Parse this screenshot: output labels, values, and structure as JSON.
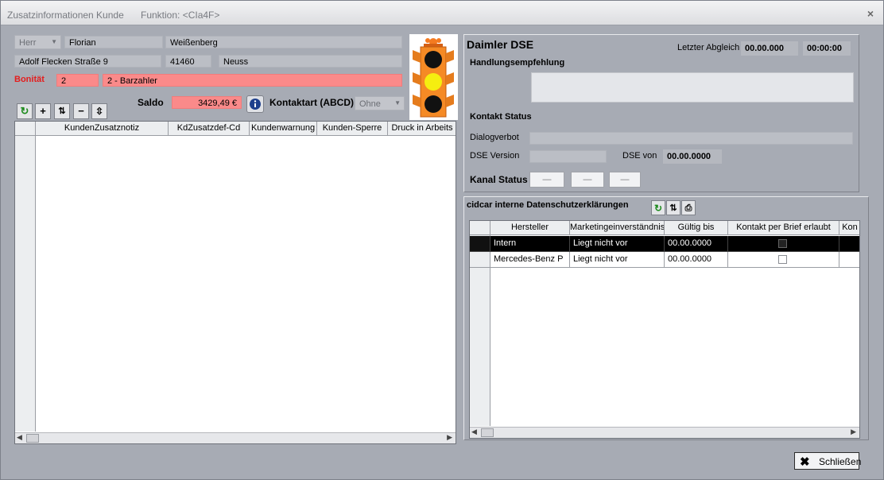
{
  "window": {
    "title": "Zusatzinformationen Kunde",
    "function": "Funktion: <CIa4F>",
    "close_glyph": "×"
  },
  "customer": {
    "salutation": "Herr",
    "first_name": "Florian",
    "last_name": "Weißenberg",
    "street": "Adolf Flecken Straße 9",
    "zip": "41460",
    "city": "Neuss",
    "bonitaet_label": "Bonität",
    "bonitaet_code": "2",
    "bonitaet_text": "2 - Barzahler",
    "saldo_label": "Saldo",
    "saldo_value": "3429,49 €",
    "kontaktart_label": "Kontaktart (ABCD)",
    "kontaktart_value": "Ohne"
  },
  "toolbar_left": {
    "refresh": "↻",
    "add": "+",
    "columns": "⇅",
    "remove": "−",
    "sort": "⇳"
  },
  "notes_grid": {
    "columns": [
      "KundenZusatznotiz",
      "KdZusatzdef-Cd",
      "Kundenwarnung",
      "Kunden-Sperre",
      "Druck in Arbeits"
    ]
  },
  "dse": {
    "title": "Daimler DSE",
    "last_sync_label": "Letzter Abgleich",
    "last_sync_date": "00.00.000",
    "last_sync_time": "00:00:00",
    "handlungsempfehlung_label": "Handlungsempfehlung",
    "kontakt_status_label": "Kontakt Status",
    "dialogverbot_label": "Dialogverbot",
    "dse_version_label": "DSE Version",
    "dse_von_label": "DSE von",
    "dse_von_value": "00.00.0000",
    "kanal_status_label": "Kanal Status",
    "kanal_values": [
      "—",
      "—",
      "—"
    ]
  },
  "cidcar": {
    "title": "cidcar interne Datenschutzerklärungen",
    "columns": [
      "Hersteller",
      "Marketingeinverständnis",
      "Gültig bis",
      "Kontakt per Brief erlaubt",
      "Kon"
    ],
    "rows": [
      {
        "hersteller": "Intern",
        "marketing": "Liegt nicht vor",
        "gueltig": "00.00.0000"
      },
      {
        "hersteller": "Mercedes-Benz P",
        "marketing": "Liegt nicht vor",
        "gueltig": "00.00.0000"
      }
    ]
  },
  "buttons": {
    "close_label": "Schließen"
  },
  "colors": {
    "window_bg": "#a7abb4",
    "field_bg": "#bbbec5",
    "warning_bg": "#fa8a8a",
    "selected_row_bg": "#000000"
  }
}
